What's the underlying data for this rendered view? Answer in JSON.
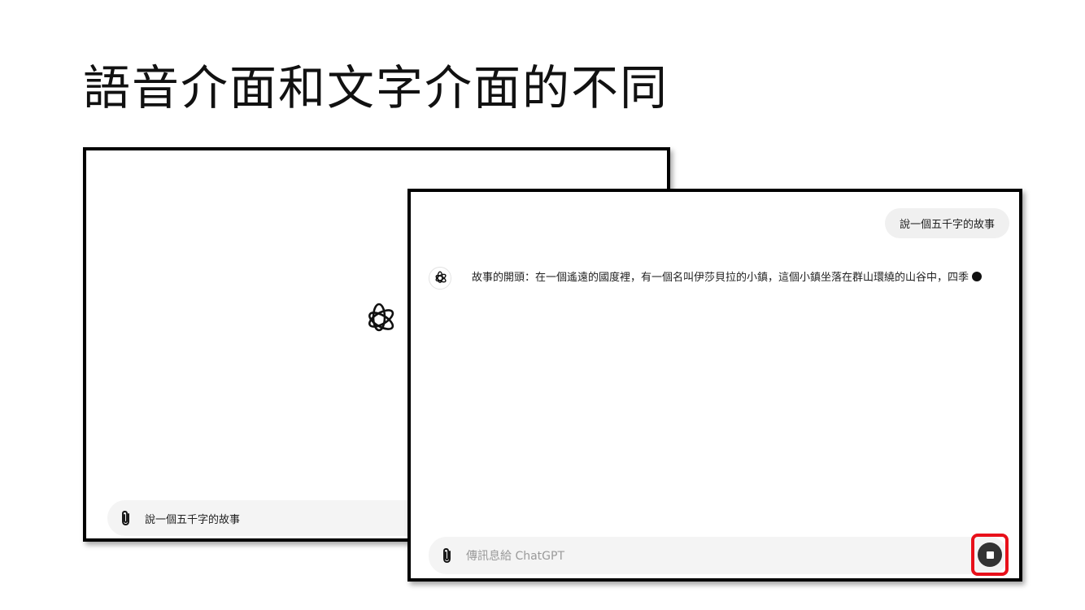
{
  "slide": {
    "title": "語音介面和文字介面的不同"
  },
  "voice_panel": {
    "input_value": "說一個五千字的故事",
    "icons": {
      "center": "openai-logo-icon",
      "attach": "paperclip-icon"
    }
  },
  "text_panel": {
    "user_message": "說一個五千字的故事",
    "assistant_message": "故事的開頭：在一個遙遠的國度裡，有一個名叫伊莎貝拉的小鎮，這個小鎮坐落在群山環繞的山谷中，四季",
    "input_placeholder": "傳訊息給 ChatGPT",
    "icons": {
      "avatar": "openai-logo-icon",
      "attach": "paperclip-icon",
      "stop": "stop-square-icon",
      "typing": "streaming-dot-icon"
    }
  },
  "colors": {
    "highlight": "#e8101a",
    "composer_bg": "#f4f4f4",
    "bubble_bg": "#f0f0f0",
    "stop_button": "#333333"
  }
}
